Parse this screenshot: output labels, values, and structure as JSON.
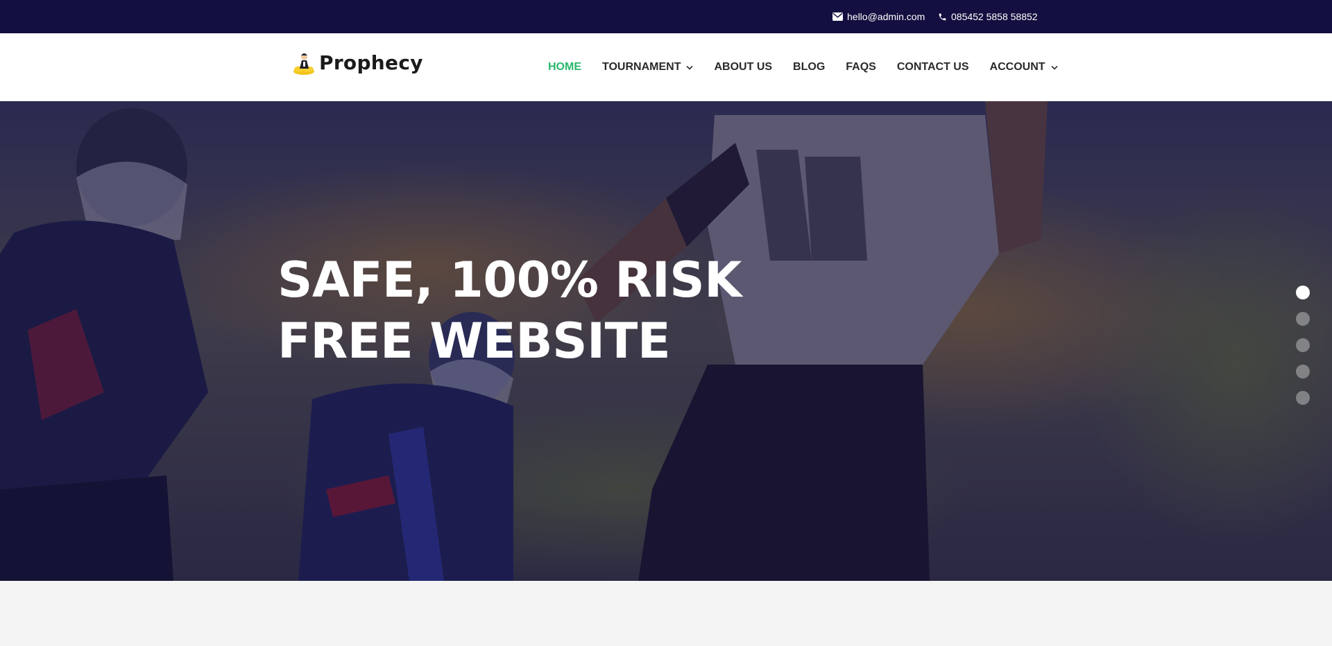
{
  "topbar": {
    "email": "hello@admin.com",
    "phone": "085452 5858 58852",
    "email_icon": "envelope-icon",
    "phone_icon": "phone-icon"
  },
  "brand": {
    "name": "Prophecy",
    "logo_icon": "prophet-on-cloud-logo"
  },
  "nav": {
    "items": [
      {
        "label": "HOME",
        "active": true,
        "dropdown": false
      },
      {
        "label": "TOURNAMENT",
        "active": false,
        "dropdown": true
      },
      {
        "label": "ABOUT US",
        "active": false,
        "dropdown": false
      },
      {
        "label": "BLOG",
        "active": false,
        "dropdown": false
      },
      {
        "label": "FAQS",
        "active": false,
        "dropdown": false
      },
      {
        "label": "CONTACT US",
        "active": false,
        "dropdown": false
      },
      {
        "label": "ACCOUNT",
        "active": false,
        "dropdown": true
      }
    ],
    "active_color": "#27b86a"
  },
  "hero": {
    "title_line1": "SAFE, 100% RISK",
    "title_line2": "FREE WEBSITE",
    "slides_total": 5,
    "active_slide": 1
  },
  "colors": {
    "topbar_bg": "#130f40",
    "overlay": "#161040",
    "text_dark": "#2a2a2a"
  }
}
